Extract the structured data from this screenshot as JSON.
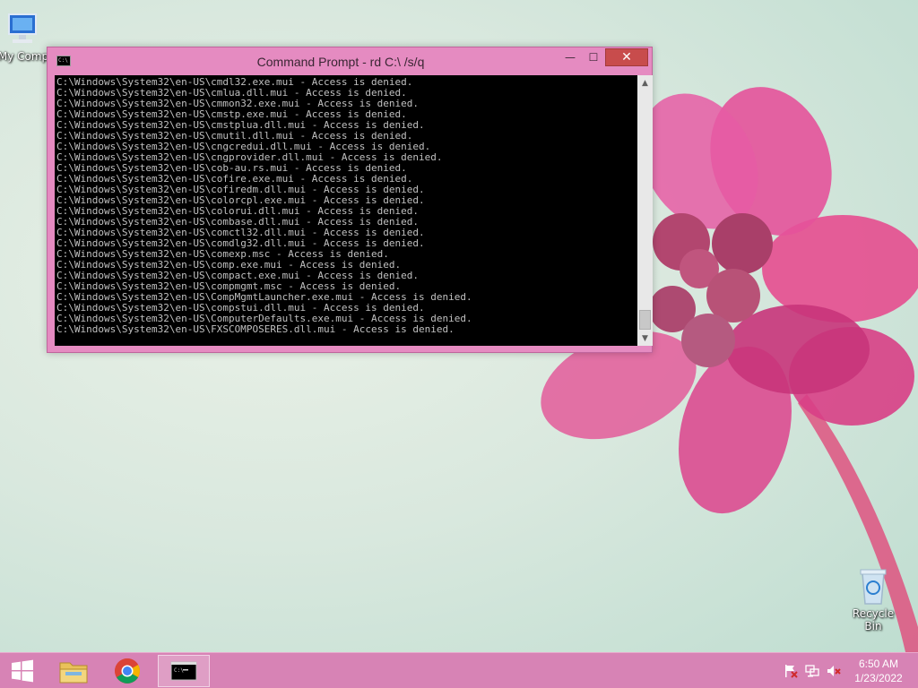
{
  "desktop": {
    "icons": [
      {
        "label": "My Comp",
        "icon": "computer-icon"
      },
      {
        "label": "Recycle Bin",
        "icon": "recycle-bin-icon"
      }
    ]
  },
  "window": {
    "title": "Command Prompt - rd  C:\\ /s/q",
    "icon_text": "C:\\",
    "minimize": "—",
    "maximize": "☐",
    "close": "✕",
    "console_lines": [
      "C:\\Windows\\System32\\en-US\\cmdl32.exe.mui - Access is denied.",
      "C:\\Windows\\System32\\en-US\\cmlua.dll.mui - Access is denied.",
      "C:\\Windows\\System32\\en-US\\cmmon32.exe.mui - Access is denied.",
      "C:\\Windows\\System32\\en-US\\cmstp.exe.mui - Access is denied.",
      "C:\\Windows\\System32\\en-US\\cmstplua.dll.mui - Access is denied.",
      "C:\\Windows\\System32\\en-US\\cmutil.dll.mui - Access is denied.",
      "C:\\Windows\\System32\\en-US\\cngcredui.dll.mui - Access is denied.",
      "C:\\Windows\\System32\\en-US\\cngprovider.dll.mui - Access is denied.",
      "C:\\Windows\\System32\\en-US\\cob-au.rs.mui - Access is denied.",
      "C:\\Windows\\System32\\en-US\\cofire.exe.mui - Access is denied.",
      "C:\\Windows\\System32\\en-US\\cofiredm.dll.mui - Access is denied.",
      "C:\\Windows\\System32\\en-US\\colorcpl.exe.mui - Access is denied.",
      "C:\\Windows\\System32\\en-US\\colorui.dll.mui - Access is denied.",
      "C:\\Windows\\System32\\en-US\\combase.dll.mui - Access is denied.",
      "C:\\Windows\\System32\\en-US\\comctl32.dll.mui - Access is denied.",
      "C:\\Windows\\System32\\en-US\\comdlg32.dll.mui - Access is denied.",
      "C:\\Windows\\System32\\en-US\\comexp.msc - Access is denied.",
      "C:\\Windows\\System32\\en-US\\comp.exe.mui - Access is denied.",
      "C:\\Windows\\System32\\en-US\\compact.exe.mui - Access is denied.",
      "C:\\Windows\\System32\\en-US\\compmgmt.msc - Access is denied.",
      "C:\\Windows\\System32\\en-US\\CompMgmtLauncher.exe.mui - Access is denied.",
      "C:\\Windows\\System32\\en-US\\compstui.dll.mui - Access is denied.",
      "C:\\Windows\\System32\\en-US\\ComputerDefaults.exe.mui - Access is denied.",
      "C:\\Windows\\System32\\en-US\\FXSCOMPOSERES.dll.mui - Access is denied."
    ]
  },
  "taskbar": {
    "items": [
      "windows-logo-icon",
      "file-explorer-icon",
      "chrome-icon",
      "command-prompt-icon"
    ],
    "tray": [
      "flag-icon",
      "network-icon",
      "volume-muted-icon"
    ],
    "time": "6:50 AM",
    "date": "1/23/2022"
  },
  "colors": {
    "window_frame": "#e58bc1",
    "taskbar": "#d783b5",
    "close_button": "#c84c4c",
    "console_bg": "#000000",
    "console_text": "#c0c0c0"
  }
}
